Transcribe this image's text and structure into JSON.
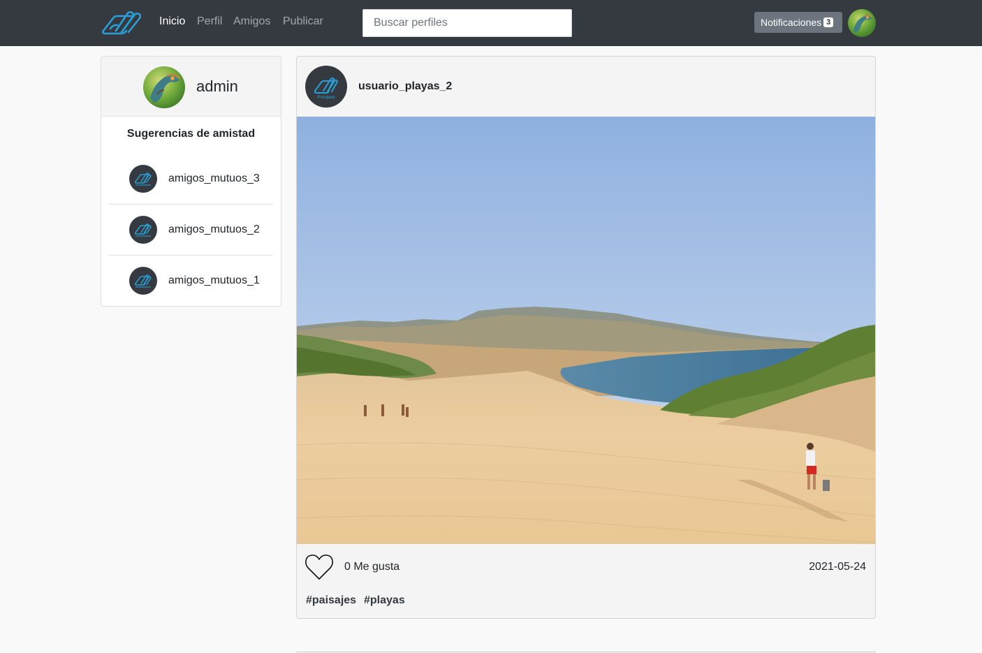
{
  "navbar": {
    "brand": "pictopeer-logo",
    "links": [
      {
        "label": "Inicio",
        "active": true
      },
      {
        "label": "Perfil",
        "active": false
      },
      {
        "label": "Amigos",
        "active": false
      },
      {
        "label": "Publicar",
        "active": false
      }
    ],
    "search_placeholder": "Buscar perfiles",
    "notifications_label": "Notificaciones",
    "notifications_count": "3",
    "colors": {
      "background": "#343a40",
      "brand": "#2a9fd6"
    }
  },
  "sidebar": {
    "username": "admin",
    "suggestions_title": "Sugerencias de amistad",
    "suggestions": [
      {
        "name": "amigos_mutuos_3"
      },
      {
        "name": "amigos_mutuos_2"
      },
      {
        "name": "amigos_mutuos_1"
      }
    ]
  },
  "post": {
    "username": "usuario_playas_2",
    "image": "beach-landscape-photo",
    "likes_label": "0 Me gusta",
    "date": "2021-05-24",
    "tags": [
      "#paisajes",
      "#playas"
    ]
  }
}
